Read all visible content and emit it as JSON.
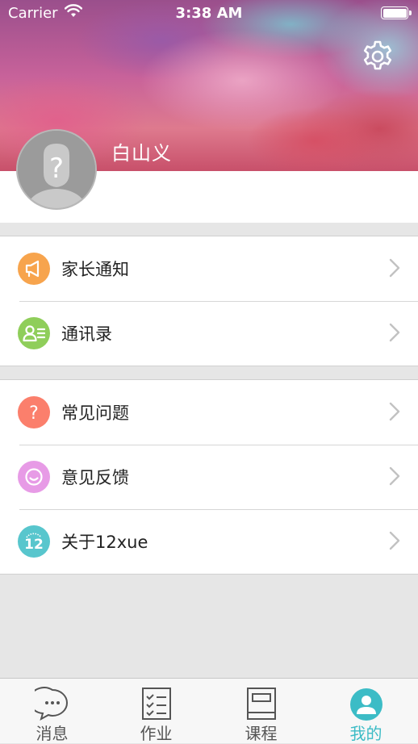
{
  "status_bar": {
    "carrier": "Carrier",
    "time": "3:38 AM"
  },
  "profile": {
    "username": "白山义"
  },
  "colors": {
    "accent": "#3cbcc6",
    "parent_notice": "#f7a44d",
    "contacts": "#8fce5a",
    "faq": "#fb7f6c",
    "feedback": "#e79be6",
    "about": "#58c6cd"
  },
  "menu_groups": [
    [
      {
        "id": "parent-notice",
        "label": "家长通知",
        "icon": "megaphone-icon"
      },
      {
        "id": "contacts",
        "label": "通讯录",
        "icon": "contacts-icon"
      }
    ],
    [
      {
        "id": "faq",
        "label": "常见问题",
        "icon": "question-icon"
      },
      {
        "id": "feedback",
        "label": "意见反馈",
        "icon": "smiley-icon"
      },
      {
        "id": "about",
        "label": "关于12xue",
        "icon": "about-12-icon"
      }
    ]
  ],
  "tabs": [
    {
      "label": "消息",
      "icon": "chat-bubble-icon"
    },
    {
      "label": "作业",
      "icon": "checklist-icon"
    },
    {
      "label": "课程",
      "icon": "book-icon"
    },
    {
      "label": "我的",
      "icon": "person-icon",
      "active": true
    }
  ]
}
